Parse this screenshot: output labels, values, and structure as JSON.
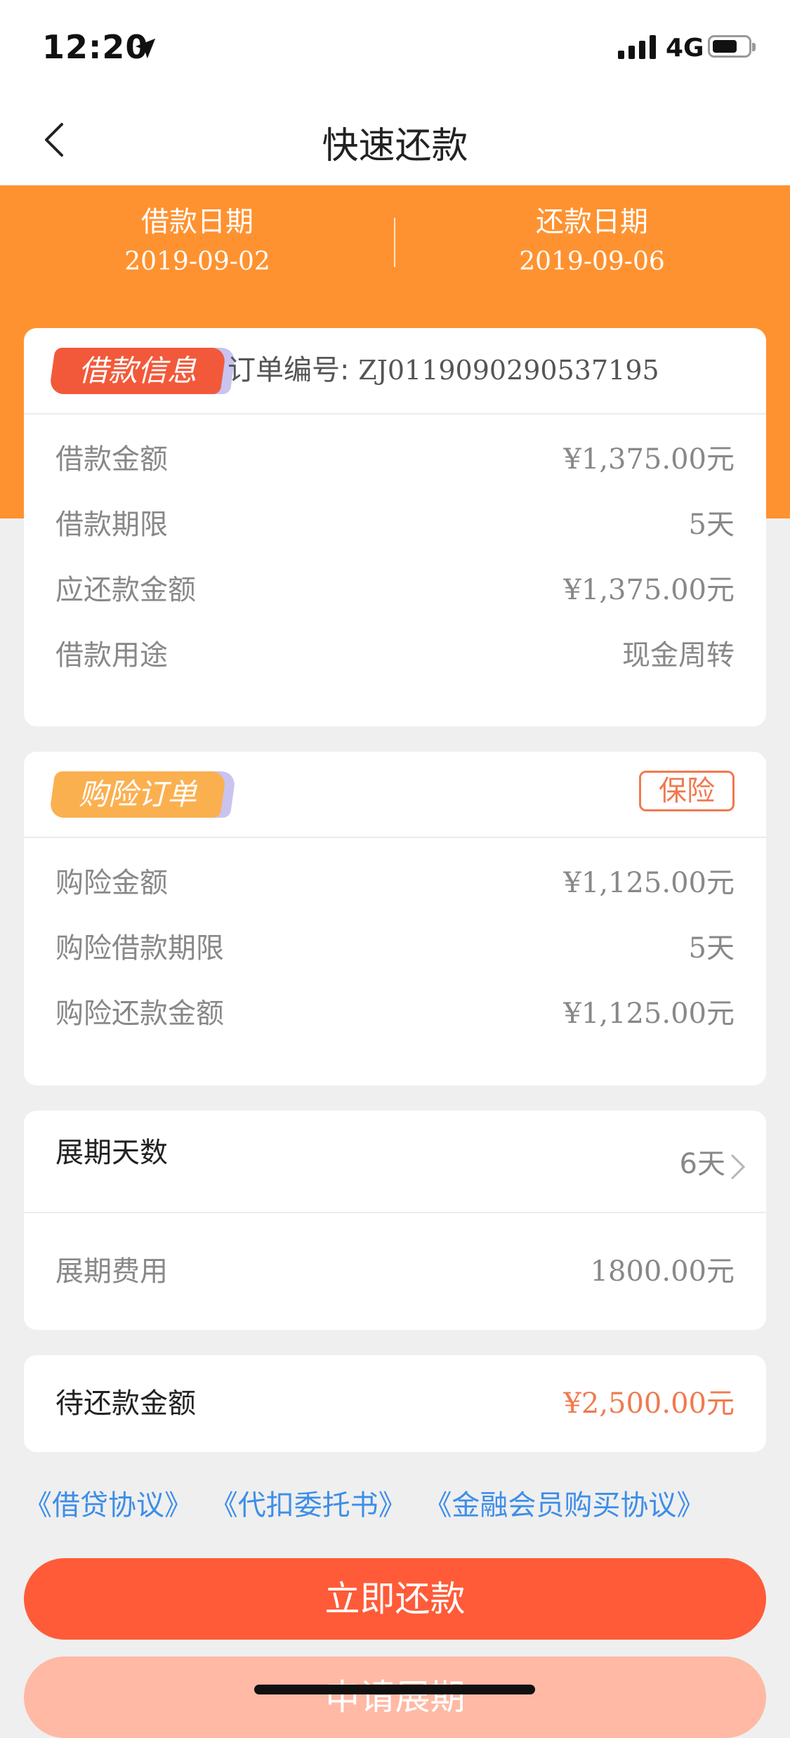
{
  "status_bar": {
    "time": "12:20",
    "network": "4G"
  },
  "nav": {
    "title": "快速还款"
  },
  "header": {
    "borrow_date_label": "借款日期",
    "borrow_date": "2019-09-02",
    "repay_date_label": "还款日期",
    "repay_date": "2019-09-06",
    "background_color": "#ff9230"
  },
  "loan_info": {
    "tag": "借款信息",
    "order_label": "订单编号:",
    "order_number": "ZJ0119090290537195",
    "rows": [
      {
        "label": "借款金额",
        "value": "¥1,375.00元"
      },
      {
        "label": "借款期限",
        "value": "5天"
      },
      {
        "label": "应还款金额",
        "value": "¥1,375.00元"
      },
      {
        "label": "借款用途",
        "value": "现金周转"
      }
    ]
  },
  "insurance": {
    "tag": "购险订单",
    "badge": "保险",
    "rows": [
      {
        "label": "购险金额",
        "value": "¥1,125.00元"
      },
      {
        "label": "购险借款期限",
        "value": "5天"
      },
      {
        "label": "购险还款金额",
        "value": "¥1,125.00元"
      }
    ]
  },
  "extension": {
    "days_label": "展期天数",
    "days_value": "6天",
    "fee_label": "展期费用",
    "fee_value": "1800.00元"
  },
  "pending": {
    "label": "待还款金额",
    "value": "¥2,500.00元",
    "value_color": "#f07a4f"
  },
  "agreements": [
    "《借贷协议》",
    "《代扣委托书》",
    "《金融会员购买协议》"
  ],
  "buttons": {
    "repay_now": "立即还款",
    "apply_extension": "申请展期"
  }
}
